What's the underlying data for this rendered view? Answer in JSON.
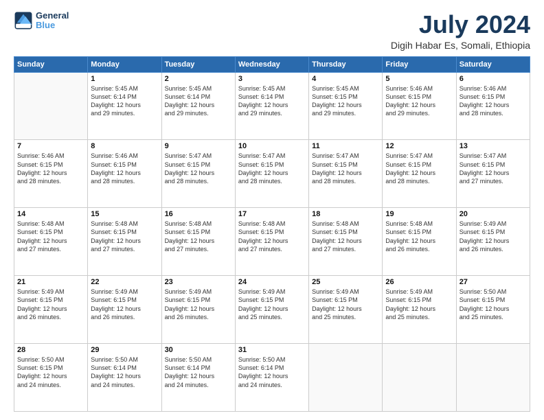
{
  "logo": {
    "line1": "General",
    "line2": "Blue"
  },
  "title": "July 2024",
  "location": "Digih Habar Es, Somali, Ethiopia",
  "days_of_week": [
    "Sunday",
    "Monday",
    "Tuesday",
    "Wednesday",
    "Thursday",
    "Friday",
    "Saturday"
  ],
  "weeks": [
    [
      {
        "day": "",
        "sunrise": "",
        "sunset": "",
        "daylight": ""
      },
      {
        "day": "1",
        "sunrise": "5:45 AM",
        "sunset": "6:14 PM",
        "daylight": "12 hours and 29 minutes."
      },
      {
        "day": "2",
        "sunrise": "5:45 AM",
        "sunset": "6:14 PM",
        "daylight": "12 hours and 29 minutes."
      },
      {
        "day": "3",
        "sunrise": "5:45 AM",
        "sunset": "6:14 PM",
        "daylight": "12 hours and 29 minutes."
      },
      {
        "day": "4",
        "sunrise": "5:45 AM",
        "sunset": "6:15 PM",
        "daylight": "12 hours and 29 minutes."
      },
      {
        "day": "5",
        "sunrise": "5:46 AM",
        "sunset": "6:15 PM",
        "daylight": "12 hours and 29 minutes."
      },
      {
        "day": "6",
        "sunrise": "5:46 AM",
        "sunset": "6:15 PM",
        "daylight": "12 hours and 28 minutes."
      }
    ],
    [
      {
        "day": "7",
        "sunrise": "5:46 AM",
        "sunset": "6:15 PM",
        "daylight": "12 hours and 28 minutes."
      },
      {
        "day": "8",
        "sunrise": "5:46 AM",
        "sunset": "6:15 PM",
        "daylight": "12 hours and 28 minutes."
      },
      {
        "day": "9",
        "sunrise": "5:47 AM",
        "sunset": "6:15 PM",
        "daylight": "12 hours and 28 minutes."
      },
      {
        "day": "10",
        "sunrise": "5:47 AM",
        "sunset": "6:15 PM",
        "daylight": "12 hours and 28 minutes."
      },
      {
        "day": "11",
        "sunrise": "5:47 AM",
        "sunset": "6:15 PM",
        "daylight": "12 hours and 28 minutes."
      },
      {
        "day": "12",
        "sunrise": "5:47 AM",
        "sunset": "6:15 PM",
        "daylight": "12 hours and 28 minutes."
      },
      {
        "day": "13",
        "sunrise": "5:47 AM",
        "sunset": "6:15 PM",
        "daylight": "12 hours and 27 minutes."
      }
    ],
    [
      {
        "day": "14",
        "sunrise": "5:48 AM",
        "sunset": "6:15 PM",
        "daylight": "12 hours and 27 minutes."
      },
      {
        "day": "15",
        "sunrise": "5:48 AM",
        "sunset": "6:15 PM",
        "daylight": "12 hours and 27 minutes."
      },
      {
        "day": "16",
        "sunrise": "5:48 AM",
        "sunset": "6:15 PM",
        "daylight": "12 hours and 27 minutes."
      },
      {
        "day": "17",
        "sunrise": "5:48 AM",
        "sunset": "6:15 PM",
        "daylight": "12 hours and 27 minutes."
      },
      {
        "day": "18",
        "sunrise": "5:48 AM",
        "sunset": "6:15 PM",
        "daylight": "12 hours and 27 minutes."
      },
      {
        "day": "19",
        "sunrise": "5:48 AM",
        "sunset": "6:15 PM",
        "daylight": "12 hours and 26 minutes."
      },
      {
        "day": "20",
        "sunrise": "5:49 AM",
        "sunset": "6:15 PM",
        "daylight": "12 hours and 26 minutes."
      }
    ],
    [
      {
        "day": "21",
        "sunrise": "5:49 AM",
        "sunset": "6:15 PM",
        "daylight": "12 hours and 26 minutes."
      },
      {
        "day": "22",
        "sunrise": "5:49 AM",
        "sunset": "6:15 PM",
        "daylight": "12 hours and 26 minutes."
      },
      {
        "day": "23",
        "sunrise": "5:49 AM",
        "sunset": "6:15 PM",
        "daylight": "12 hours and 26 minutes."
      },
      {
        "day": "24",
        "sunrise": "5:49 AM",
        "sunset": "6:15 PM",
        "daylight": "12 hours and 25 minutes."
      },
      {
        "day": "25",
        "sunrise": "5:49 AM",
        "sunset": "6:15 PM",
        "daylight": "12 hours and 25 minutes."
      },
      {
        "day": "26",
        "sunrise": "5:49 AM",
        "sunset": "6:15 PM",
        "daylight": "12 hours and 25 minutes."
      },
      {
        "day": "27",
        "sunrise": "5:50 AM",
        "sunset": "6:15 PM",
        "daylight": "12 hours and 25 minutes."
      }
    ],
    [
      {
        "day": "28",
        "sunrise": "5:50 AM",
        "sunset": "6:15 PM",
        "daylight": "12 hours and 24 minutes."
      },
      {
        "day": "29",
        "sunrise": "5:50 AM",
        "sunset": "6:14 PM",
        "daylight": "12 hours and 24 minutes."
      },
      {
        "day": "30",
        "sunrise": "5:50 AM",
        "sunset": "6:14 PM",
        "daylight": "12 hours and 24 minutes."
      },
      {
        "day": "31",
        "sunrise": "5:50 AM",
        "sunset": "6:14 PM",
        "daylight": "12 hours and 24 minutes."
      },
      {
        "day": "",
        "sunrise": "",
        "sunset": "",
        "daylight": ""
      },
      {
        "day": "",
        "sunrise": "",
        "sunset": "",
        "daylight": ""
      },
      {
        "day": "",
        "sunrise": "",
        "sunset": "",
        "daylight": ""
      }
    ]
  ],
  "labels": {
    "sunrise_prefix": "Sunrise: ",
    "sunset_prefix": "Sunset: ",
    "daylight_prefix": "Daylight: "
  }
}
